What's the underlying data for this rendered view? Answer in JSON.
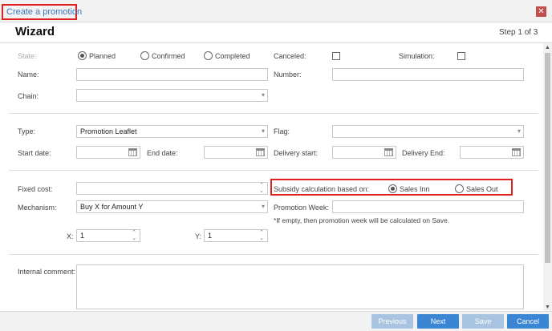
{
  "window": {
    "title": "Create a promotion",
    "close_glyph": "✕"
  },
  "header": {
    "title": "Wizard",
    "step": "Step 1 of 3"
  },
  "status": {
    "label": "State:",
    "options": [
      "Planned",
      "Confirmed",
      "Completed"
    ],
    "selected": "Planned"
  },
  "flags": {
    "canceled_label": "Canceled:",
    "simulation_label": "Simulation:"
  },
  "fields": {
    "name_label": "Name:",
    "name_value": "",
    "number_label": "Number:",
    "number_value": "",
    "chain_label": "Chain:",
    "chain_value": "",
    "type_label": "Type:",
    "type_value": "Promotion Leaflet",
    "flag_label": "Flag:",
    "flag_value": "",
    "start_date_label": "Start date:",
    "end_date_label": "End date:",
    "delivery_start_label": "Delivery start:",
    "delivery_end_label": "Delivery End:",
    "fixed_cost_label": "Fixed cost:",
    "fixed_cost_value": "",
    "mechanism_label": "Mechanism:",
    "mechanism_value": "Buy X for Amount Y",
    "promotion_week_label": "Promotion Week:",
    "promotion_week_value": "",
    "promotion_week_note": "*If empty, then promotion week will be calculated on Save.",
    "x_label": "X:",
    "x_value": "1",
    "y_label": "Y:",
    "y_value": "1",
    "internal_comment_label": "Internal comment:"
  },
  "subsidy": {
    "label": "Subsidy calculation based on:",
    "options": [
      "Sales Inn",
      "Sales Out"
    ],
    "selected": "Sales Inn"
  },
  "footer": {
    "previous": "Previous",
    "next": "Next",
    "save": "Save",
    "cancel": "Cancel"
  },
  "icons": {
    "dropdown": "▾",
    "spinner_up": "⌃",
    "spinner_down": "⌄",
    "scroll_up": "▲",
    "scroll_down": "▼"
  },
  "colors": {
    "highlight": "#e0201e",
    "link": "#3b77bc",
    "primary_button": "#3a86d4",
    "disabled_button": "#a9c4e0"
  }
}
